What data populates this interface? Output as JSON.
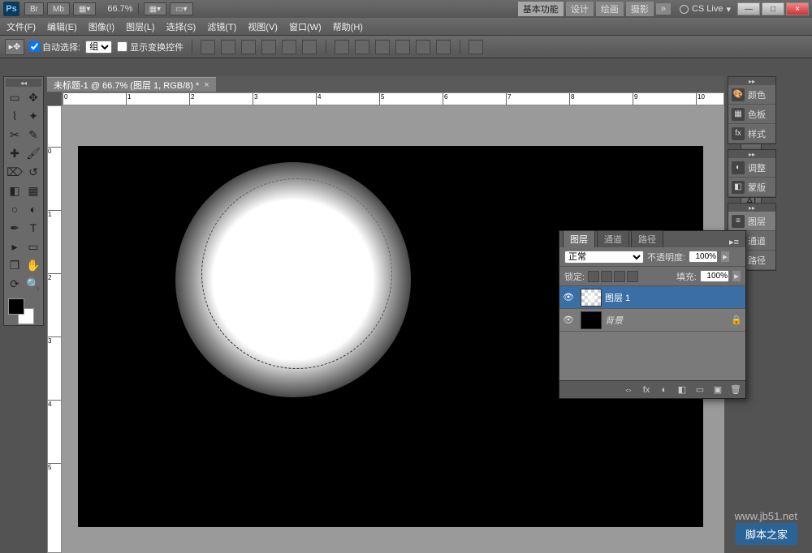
{
  "title_bar": {
    "app": "Ps",
    "buttons": [
      "Br",
      "Mb"
    ],
    "zoom": "66.7%",
    "workspaces": [
      "基本功能",
      "设计",
      "绘画",
      "摄影"
    ],
    "more": "»",
    "cslive": "CS Live",
    "min": "—",
    "max": "□",
    "close": "×"
  },
  "menu": [
    "文件(F)",
    "编辑(E)",
    "图像(I)",
    "图层(L)",
    "选择(S)",
    "滤镜(T)",
    "视图(V)",
    "窗口(W)",
    "帮助(H)"
  ],
  "options": {
    "auto_select": "自动选择:",
    "group": "组",
    "show_transform": "显示变换控件"
  },
  "doc_tab": "未标题-1 @ 66.7% (图层 1, RGB/8) *",
  "ruler_h": [
    "0",
    "1",
    "2",
    "3",
    "4",
    "5",
    "6",
    "7",
    "8",
    "9",
    "10"
  ],
  "ruler_v": [
    "0",
    "1",
    "2",
    "3",
    "4",
    "5"
  ],
  "right_panels": {
    "group1": [
      "颜色",
      "色板",
      "样式"
    ],
    "group2": [
      "调整",
      "蒙版"
    ],
    "group3": [
      "图层",
      "通道",
      "路径"
    ]
  },
  "layers_panel": {
    "tabs": [
      "图层",
      "通道",
      "路径"
    ],
    "blend_mode": "正常",
    "opacity_label": "不透明度:",
    "opacity": "100%",
    "lock_label": "锁定:",
    "fill_label": "填充:",
    "fill": "100%",
    "layers": [
      {
        "name": "图层 1",
        "selected": true,
        "bg": false
      },
      {
        "name": "背景",
        "selected": false,
        "bg": true
      }
    ],
    "footer_icons": [
      "⇔",
      "fx",
      "◐",
      "◧",
      "▭",
      "▣",
      "🗑"
    ]
  },
  "watermark": "www.jb51.net",
  "watermark2": "脚本之家"
}
